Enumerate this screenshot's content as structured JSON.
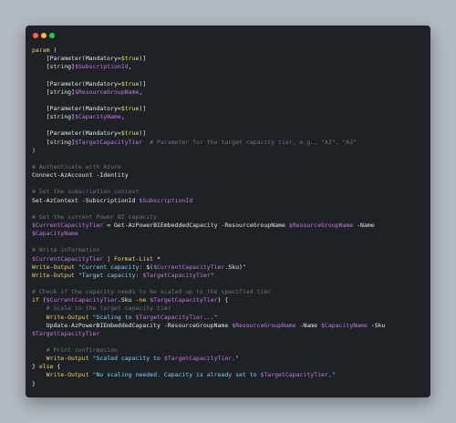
{
  "colors": {
    "background": "#b3bac2",
    "editor": "#1e2227",
    "close": "#ff5f56",
    "minimize": "#ffbd2e",
    "maximize": "#27c93f",
    "keyword": "#f0d06b",
    "variable": "#c678dd",
    "string": "#7fd3f0",
    "comment": "#6a737d",
    "text": "#e6e6e6"
  },
  "window_controls": [
    "close-dot",
    "minimize-dot",
    "maximize-dot"
  ],
  "code_lines": [
    [
      {
        "t": "param",
        "c": "keyword"
      },
      {
        "t": " (",
        "c": "text"
      }
    ],
    [
      {
        "t": "    [Parameter(Mandatory=",
        "c": "text"
      },
      {
        "t": "$true",
        "c": "bool"
      },
      {
        "t": ")]",
        "c": "text"
      }
    ],
    [
      {
        "t": "    [string]",
        "c": "text"
      },
      {
        "t": "$SubscriptionId",
        "c": "var"
      },
      {
        "t": ",",
        "c": "text"
      }
    ],
    [],
    [
      {
        "t": "    [Parameter(Mandatory=",
        "c": "text"
      },
      {
        "t": "$true",
        "c": "bool"
      },
      {
        "t": ")]",
        "c": "text"
      }
    ],
    [
      {
        "t": "    [string]",
        "c": "text"
      },
      {
        "t": "$ResourceGroupName",
        "c": "var"
      },
      {
        "t": ",",
        "c": "text"
      }
    ],
    [],
    [
      {
        "t": "    [Parameter(Mandatory=",
        "c": "text"
      },
      {
        "t": "$true",
        "c": "bool"
      },
      {
        "t": ")]",
        "c": "text"
      }
    ],
    [
      {
        "t": "    [string]",
        "c": "text"
      },
      {
        "t": "$CapacityName",
        "c": "var"
      },
      {
        "t": ",",
        "c": "text"
      }
    ],
    [],
    [
      {
        "t": "    [Parameter(Mandatory=",
        "c": "text"
      },
      {
        "t": "$true",
        "c": "bool"
      },
      {
        "t": ")]",
        "c": "text"
      }
    ],
    [
      {
        "t": "    [string]",
        "c": "text"
      },
      {
        "t": "$TargetCapacityTier",
        "c": "var"
      },
      {
        "t": "  # Parameter for the target capacity tier, e.g., \"A2\", \"A3\"",
        "c": "comment"
      }
    ],
    [
      {
        "t": ")",
        "c": "text"
      }
    ],
    [],
    [
      {
        "t": "# Authenticate with Azure",
        "c": "comment"
      }
    ],
    [
      {
        "t": "Connect-AzAccount -Identity",
        "c": "text"
      }
    ],
    [],
    [
      {
        "t": "# Set the subscription context",
        "c": "comment"
      }
    ],
    [
      {
        "t": "Set-AzContext -SubscriptionId ",
        "c": "text"
      },
      {
        "t": "$SubscriptionId",
        "c": "var"
      }
    ],
    [],
    [
      {
        "t": "# Get the current Power BI capacity",
        "c": "comment"
      }
    ],
    [
      {
        "t": "$CurrentCapacityTier",
        "c": "var"
      },
      {
        "t": " = Get-AzPowerBIEmbeddedCapacity -ResourceGroupName ",
        "c": "text"
      },
      {
        "t": "$ResourceGroupName",
        "c": "var"
      },
      {
        "t": " -Name",
        "c": "text"
      }
    ],
    [
      {
        "t": "$CapacityName",
        "c": "var"
      }
    ],
    [],
    [
      {
        "t": "# Write information",
        "c": "comment"
      }
    ],
    [
      {
        "t": "$CurrentCapacityTier",
        "c": "var"
      },
      {
        "t": " | ",
        "c": "text"
      },
      {
        "t": "Format-List",
        "c": "keyword"
      },
      {
        "t": " *",
        "c": "text"
      }
    ],
    [
      {
        "t": "Write-Output",
        "c": "keyword"
      },
      {
        "t": " \"Current capacity: ",
        "c": "string"
      },
      {
        "t": "$(",
        "c": "text"
      },
      {
        "t": "$CurrentCapacityTier",
        "c": "var"
      },
      {
        "t": ".Sku)",
        "c": "text"
      },
      {
        "t": "\"",
        "c": "string"
      }
    ],
    [
      {
        "t": "Write-Output",
        "c": "keyword"
      },
      {
        "t": " \"Target capacity: ",
        "c": "string"
      },
      {
        "t": "$TargetCapacityTier",
        "c": "var"
      },
      {
        "t": "\"",
        "c": "string"
      }
    ],
    [],
    [
      {
        "t": "# Check if the capacity needs to be scaled up to the specified tier",
        "c": "comment"
      }
    ],
    [
      {
        "t": "if",
        "c": "keyword"
      },
      {
        "t": " (",
        "c": "text"
      },
      {
        "t": "$CurrentCapacityTier",
        "c": "var"
      },
      {
        "t": ".Sku ",
        "c": "text"
      },
      {
        "t": "-ne",
        "c": "keyword"
      },
      {
        "t": " ",
        "c": "text"
      },
      {
        "t": "$TargetCapacityTier",
        "c": "var"
      },
      {
        "t": ") {",
        "c": "text"
      }
    ],
    [
      {
        "t": "    # Scale to the target capacity tier",
        "c": "comment"
      }
    ],
    [
      {
        "t": "    Write-Output",
        "c": "keyword"
      },
      {
        "t": " \"Scaling to ",
        "c": "string"
      },
      {
        "t": "$TargetCapacityTier",
        "c": "var"
      },
      {
        "t": "...\"",
        "c": "string"
      }
    ],
    [
      {
        "t": "    Update-AzPowerBIEmbeddedCapacity -ResourceGroupName ",
        "c": "text"
      },
      {
        "t": "$ResourceGroupName",
        "c": "var"
      },
      {
        "t": " -Name ",
        "c": "text"
      },
      {
        "t": "$CapacityName",
        "c": "var"
      },
      {
        "t": " -Sku",
        "c": "text"
      }
    ],
    [
      {
        "t": "$TargetCapacityTier",
        "c": "var"
      }
    ],
    [],
    [
      {
        "t": "    # Print confirmation",
        "c": "comment"
      }
    ],
    [
      {
        "t": "    Write-Output",
        "c": "keyword"
      },
      {
        "t": " \"Scaled capacity to ",
        "c": "string"
      },
      {
        "t": "$TargetCapacityTier",
        "c": "var"
      },
      {
        "t": ".\"",
        "c": "string"
      }
    ],
    [
      {
        "t": "} ",
        "c": "text"
      },
      {
        "t": "else",
        "c": "keyword"
      },
      {
        "t": " {",
        "c": "text"
      }
    ],
    [
      {
        "t": "    Write-Output",
        "c": "keyword"
      },
      {
        "t": " \"No scaling needed. Capacity is already set to ",
        "c": "string"
      },
      {
        "t": "$TargetCapacityTier",
        "c": "var"
      },
      {
        "t": ".\"",
        "c": "string"
      }
    ],
    [
      {
        "t": "}",
        "c": "text"
      }
    ]
  ]
}
